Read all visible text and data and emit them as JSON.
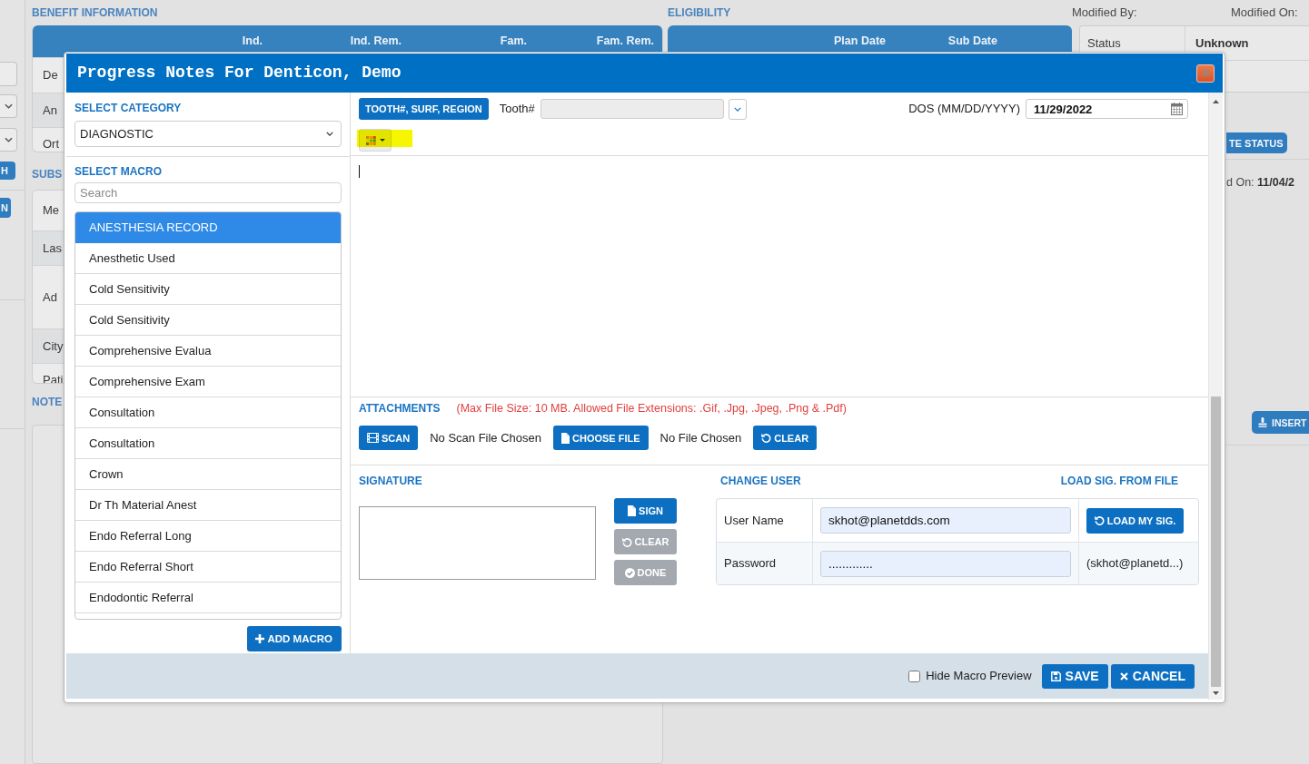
{
  "background_page": {
    "left_strip": {
      "buttons": [
        {
          "label": "H"
        },
        {
          "label": "N"
        }
      ]
    },
    "benefit_information": {
      "title": "BENEFIT INFORMATION",
      "columns": [
        "Ind.",
        "Ind. Rem.",
        "Fam.",
        "Fam. Rem."
      ],
      "rows": [
        "De",
        "An",
        "Ort"
      ]
    },
    "subscriber": {
      "title": "SUBS",
      "rows": [
        "Me",
        "Las",
        "Ad",
        "City",
        "Pati"
      ]
    },
    "notes": {
      "title": "NOTE"
    },
    "eligibility": {
      "title": "ELIGIBILITY",
      "columns": [
        "Plan Date",
        "Sub Date"
      ]
    },
    "modified_by": "Modified By:",
    "modified_on": "Modified On:",
    "status": {
      "label": "Status",
      "value": "Unknown"
    },
    "status_button": {
      "label": "TE STATUS"
    },
    "date_text": "d On: **11/04/2**",
    "insert_button": {
      "label": "INSERT"
    }
  },
  "dialog": {
    "title": "Progress Notes For Denticon, Demo",
    "macro_panel": {
      "category_label": "SELECT CATEGORY",
      "category_select": {
        "value": "DIAGNOSTIC"
      },
      "macro_label": "SELECT MACRO",
      "search_field": {
        "placeholder": "Search"
      },
      "macros": [
        {
          "label": "ANESTHESIA RECORD",
          "selected": true
        },
        {
          "label": "Anesthetic Used",
          "selected": false
        },
        {
          "label": "Cold Sensitivity",
          "selected": false
        },
        {
          "label": "Cold Sensitivity",
          "selected": false
        },
        {
          "label": "Comprehensive Evalua",
          "selected": false
        },
        {
          "label": "Comprehensive Exam",
          "selected": false
        },
        {
          "label": "Consultation",
          "selected": false
        },
        {
          "label": "Consultation",
          "selected": false
        },
        {
          "label": "Crown",
          "selected": false
        },
        {
          "label": "Dr Th Material Anest",
          "selected": false
        },
        {
          "label": "Endo Referral Long",
          "selected": false
        },
        {
          "label": "Endo Referral Short",
          "selected": false
        },
        {
          "label": "Endodontic Referral",
          "selected": false
        }
      ],
      "add_button": {
        "label": "ADD MACRO"
      }
    },
    "toolbar": {
      "tooth_button": {
        "label": "TOOTH#, SURF, REGION"
      },
      "tooth_label": "Tooth#",
      "tooth_field": {
        "disabled": true
      },
      "dos_label": "DOS (MM/DD/YYYY)",
      "dos_field": {
        "value": "11/29/2022"
      },
      "color_button": {
        "highlighted": true
      }
    },
    "attachments": {
      "title": "ATTACHMENTS",
      "note": "(Max File Size: 10 MB. Allowed File Extensions: .Gif, .Jpg, .Jpeg, .Png & .Pdf)",
      "scan_button": {
        "label": "SCAN"
      },
      "scan_status": "No Scan File Chosen",
      "choose_button": {
        "label": "CHOOSE FILE"
      },
      "file_status": "No File Chosen",
      "clear_button": {
        "label": "CLEAR"
      }
    },
    "signature": {
      "title": "SIGNATURE",
      "sign_button": {
        "label": "SIGN",
        "disabled": false
      },
      "clear_button": {
        "label": "CLEAR",
        "disabled": true
      },
      "done_button": {
        "label": "DONE",
        "disabled": true
      }
    },
    "change_user": {
      "title": "CHANGE USER",
      "load_file_link": "LOAD SIG. FROM FILE",
      "user_name": {
        "label": "User Name",
        "value": "skhot@planetdds.com"
      },
      "load_button": {
        "label": "LOAD MY SIG."
      },
      "password": {
        "label": "Password",
        "value": "............."
      },
      "account_note": "(skhot@planetd...)"
    },
    "footer": {
      "hide_preview": {
        "label": "Hide Macro Preview",
        "checked": false
      },
      "save_button": {
        "label": "SAVE"
      },
      "cancel_button": {
        "label": "CANCEL"
      }
    }
  }
}
